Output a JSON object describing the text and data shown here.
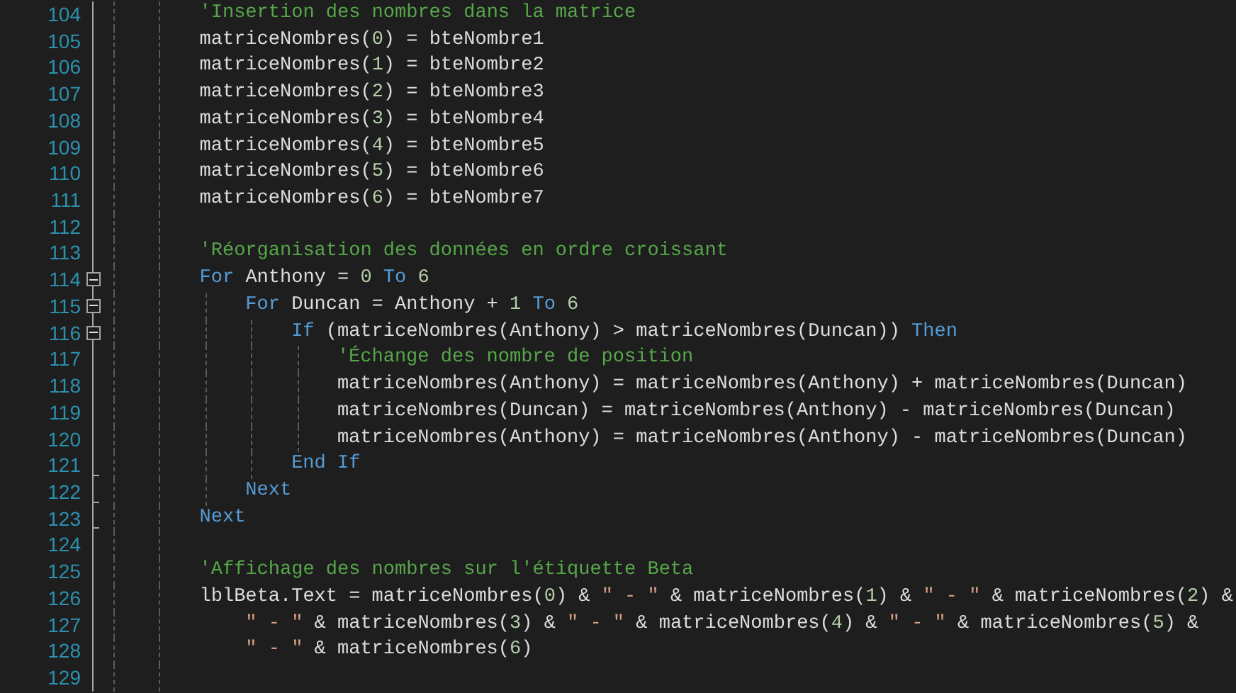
{
  "editor": {
    "lines": [
      {
        "number": "104",
        "tokens": [
          {
            "kind": "comment",
            "text": "'Insertion des nombres dans la matrice"
          }
        ]
      },
      {
        "number": "105",
        "tokens": [
          {
            "kind": "plain",
            "text": "matriceNombres("
          },
          {
            "kind": "number",
            "text": "0"
          },
          {
            "kind": "plain",
            "text": ") = bteNombre1"
          }
        ]
      },
      {
        "number": "106",
        "tokens": [
          {
            "kind": "plain",
            "text": "matriceNombres("
          },
          {
            "kind": "number",
            "text": "1"
          },
          {
            "kind": "plain",
            "text": ") = bteNombre2"
          }
        ]
      },
      {
        "number": "107",
        "tokens": [
          {
            "kind": "plain",
            "text": "matriceNombres("
          },
          {
            "kind": "number",
            "text": "2"
          },
          {
            "kind": "plain",
            "text": ") = bteNombre3"
          }
        ]
      },
      {
        "number": "108",
        "tokens": [
          {
            "kind": "plain",
            "text": "matriceNombres("
          },
          {
            "kind": "number",
            "text": "3"
          },
          {
            "kind": "plain",
            "text": ") = bteNombre4"
          }
        ]
      },
      {
        "number": "109",
        "tokens": [
          {
            "kind": "plain",
            "text": "matriceNombres("
          },
          {
            "kind": "number",
            "text": "4"
          },
          {
            "kind": "plain",
            "text": ") = bteNombre5"
          }
        ]
      },
      {
        "number": "110",
        "tokens": [
          {
            "kind": "plain",
            "text": "matriceNombres("
          },
          {
            "kind": "number",
            "text": "5"
          },
          {
            "kind": "plain",
            "text": ") = bteNombre6"
          }
        ]
      },
      {
        "number": "111",
        "tokens": [
          {
            "kind": "plain",
            "text": "matriceNombres("
          },
          {
            "kind": "number",
            "text": "6"
          },
          {
            "kind": "plain",
            "text": ") = bteNombre7"
          }
        ]
      },
      {
        "number": "112"
      },
      {
        "number": "113",
        "tokens": [
          {
            "kind": "comment",
            "text": "'Réorganisation des données en ordre croissant"
          }
        ]
      },
      {
        "number": "114",
        "tokens": [
          {
            "kind": "keyword",
            "text": "For"
          },
          {
            "kind": "plain",
            "text": " Anthony = "
          },
          {
            "kind": "number",
            "text": "0 "
          },
          {
            "kind": "keyword",
            "text": "To "
          },
          {
            "kind": "number",
            "text": "6"
          }
        ],
        "expanded": true,
        "children": [
          {
            "number": "115",
            "tokens": [
              {
                "kind": "keyword",
                "text": "For"
              },
              {
                "kind": "plain",
                "text": " Duncan = Anthony + "
              },
              {
                "kind": "number",
                "text": "1 "
              },
              {
                "kind": "keyword",
                "text": "To "
              },
              {
                "kind": "number",
                "text": "6"
              }
            ],
            "expanded": true,
            "children": [
              {
                "number": "116",
                "tokens": [
                  {
                    "kind": "keyword",
                    "text": "If"
                  },
                  {
                    "kind": "plain",
                    "text": " (matriceNombres(Anthony) > matriceNombres(Duncan)) "
                  },
                  {
                    "kind": "keyword",
                    "text": "Then"
                  }
                ],
                "expanded": true,
                "children": [
                  {
                    "number": "117",
                    "tokens": [
                      {
                        "kind": "comment",
                        "text": "'Échange des nombre de position"
                      }
                    ]
                  },
                  {
                    "number": "118",
                    "tokens": [
                      {
                        "kind": "plain",
                        "text": "matriceNombres(Anthony) = matriceNombres(Anthony) + matriceNombres(Duncan)"
                      }
                    ]
                  },
                  {
                    "number": "119",
                    "tokens": [
                      {
                        "kind": "plain",
                        "text": "matriceNombres(Duncan) = matriceNombres(Anthony) - matriceNombres(Duncan)"
                      }
                    ]
                  },
                  {
                    "number": "120",
                    "tokens": [
                      {
                        "kind": "plain",
                        "text": "matriceNombres(Anthony) = matriceNombres(Anthony) - matriceNombres(Duncan)"
                      }
                    ]
                  }
                ]
              },
              {
                "number": "121",
                "tokens": [
                  {
                    "kind": "keyword",
                    "text": "End If"
                  }
                ]
              }
            ]
          },
          {
            "number": "122",
            "tokens": [
              {
                "kind": "keyword",
                "text": "Next"
              }
            ]
          }
        ]
      },
      {
        "number": "123",
        "tokens": [
          {
            "kind": "keyword",
            "text": "Next"
          }
        ]
      },
      {
        "number": "124"
      },
      {
        "number": "125",
        "tokens": [
          {
            "kind": "comment",
            "text": "'Affichage des nombres sur l'étiquette Beta"
          }
        ]
      },
      {
        "number": "126",
        "tokens": [
          {
            "kind": "plain",
            "text": "lblBeta.Text = matriceNombres("
          },
          {
            "kind": "number",
            "text": "0"
          },
          {
            "kind": "plain",
            "text": ") & "
          },
          {
            "kind": "string",
            "text": "\" - \""
          },
          {
            "kind": "plain",
            "text": " & matriceNombres("
          },
          {
            "kind": "number",
            "text": "1"
          },
          {
            "kind": "plain",
            "text": ") & "
          },
          {
            "kind": "string",
            "text": "\" - \""
          },
          {
            "kind": "plain",
            "text": " & matriceNombres("
          },
          {
            "kind": "number",
            "text": "2"
          },
          {
            "kind": "plain",
            "text": ") &"
          }
        ]
      },
      {
        "number": "127",
        "kind": "continuation",
        "tokens": [
          {
            "kind": "string",
            "text": "\" - \""
          },
          {
            "kind": "plain",
            "text": " & matriceNombres("
          },
          {
            "kind": "number",
            "text": "3"
          },
          {
            "kind": "plain",
            "text": ") & "
          },
          {
            "kind": "string",
            "text": "\" - \""
          },
          {
            "kind": "plain",
            "text": " & matriceNombres("
          },
          {
            "kind": "number",
            "text": "4"
          },
          {
            "kind": "plain",
            "text": ") & "
          },
          {
            "kind": "string",
            "text": "\" - \""
          },
          {
            "kind": "plain",
            "text": " & matriceNombres("
          },
          {
            "kind": "number",
            "text": "5"
          },
          {
            "kind": "plain",
            "text": ") &"
          }
        ]
      },
      {
        "number": "128",
        "kind": "continuation",
        "tokens": [
          {
            "kind": "string",
            "text": "\" - \""
          },
          {
            "kind": "plain",
            "text": " & matriceNombres("
          },
          {
            "kind": "number",
            "text": "6"
          },
          {
            "kind": "plain",
            "text": ")"
          }
        ]
      },
      {
        "number": "129"
      }
    ]
  }
}
